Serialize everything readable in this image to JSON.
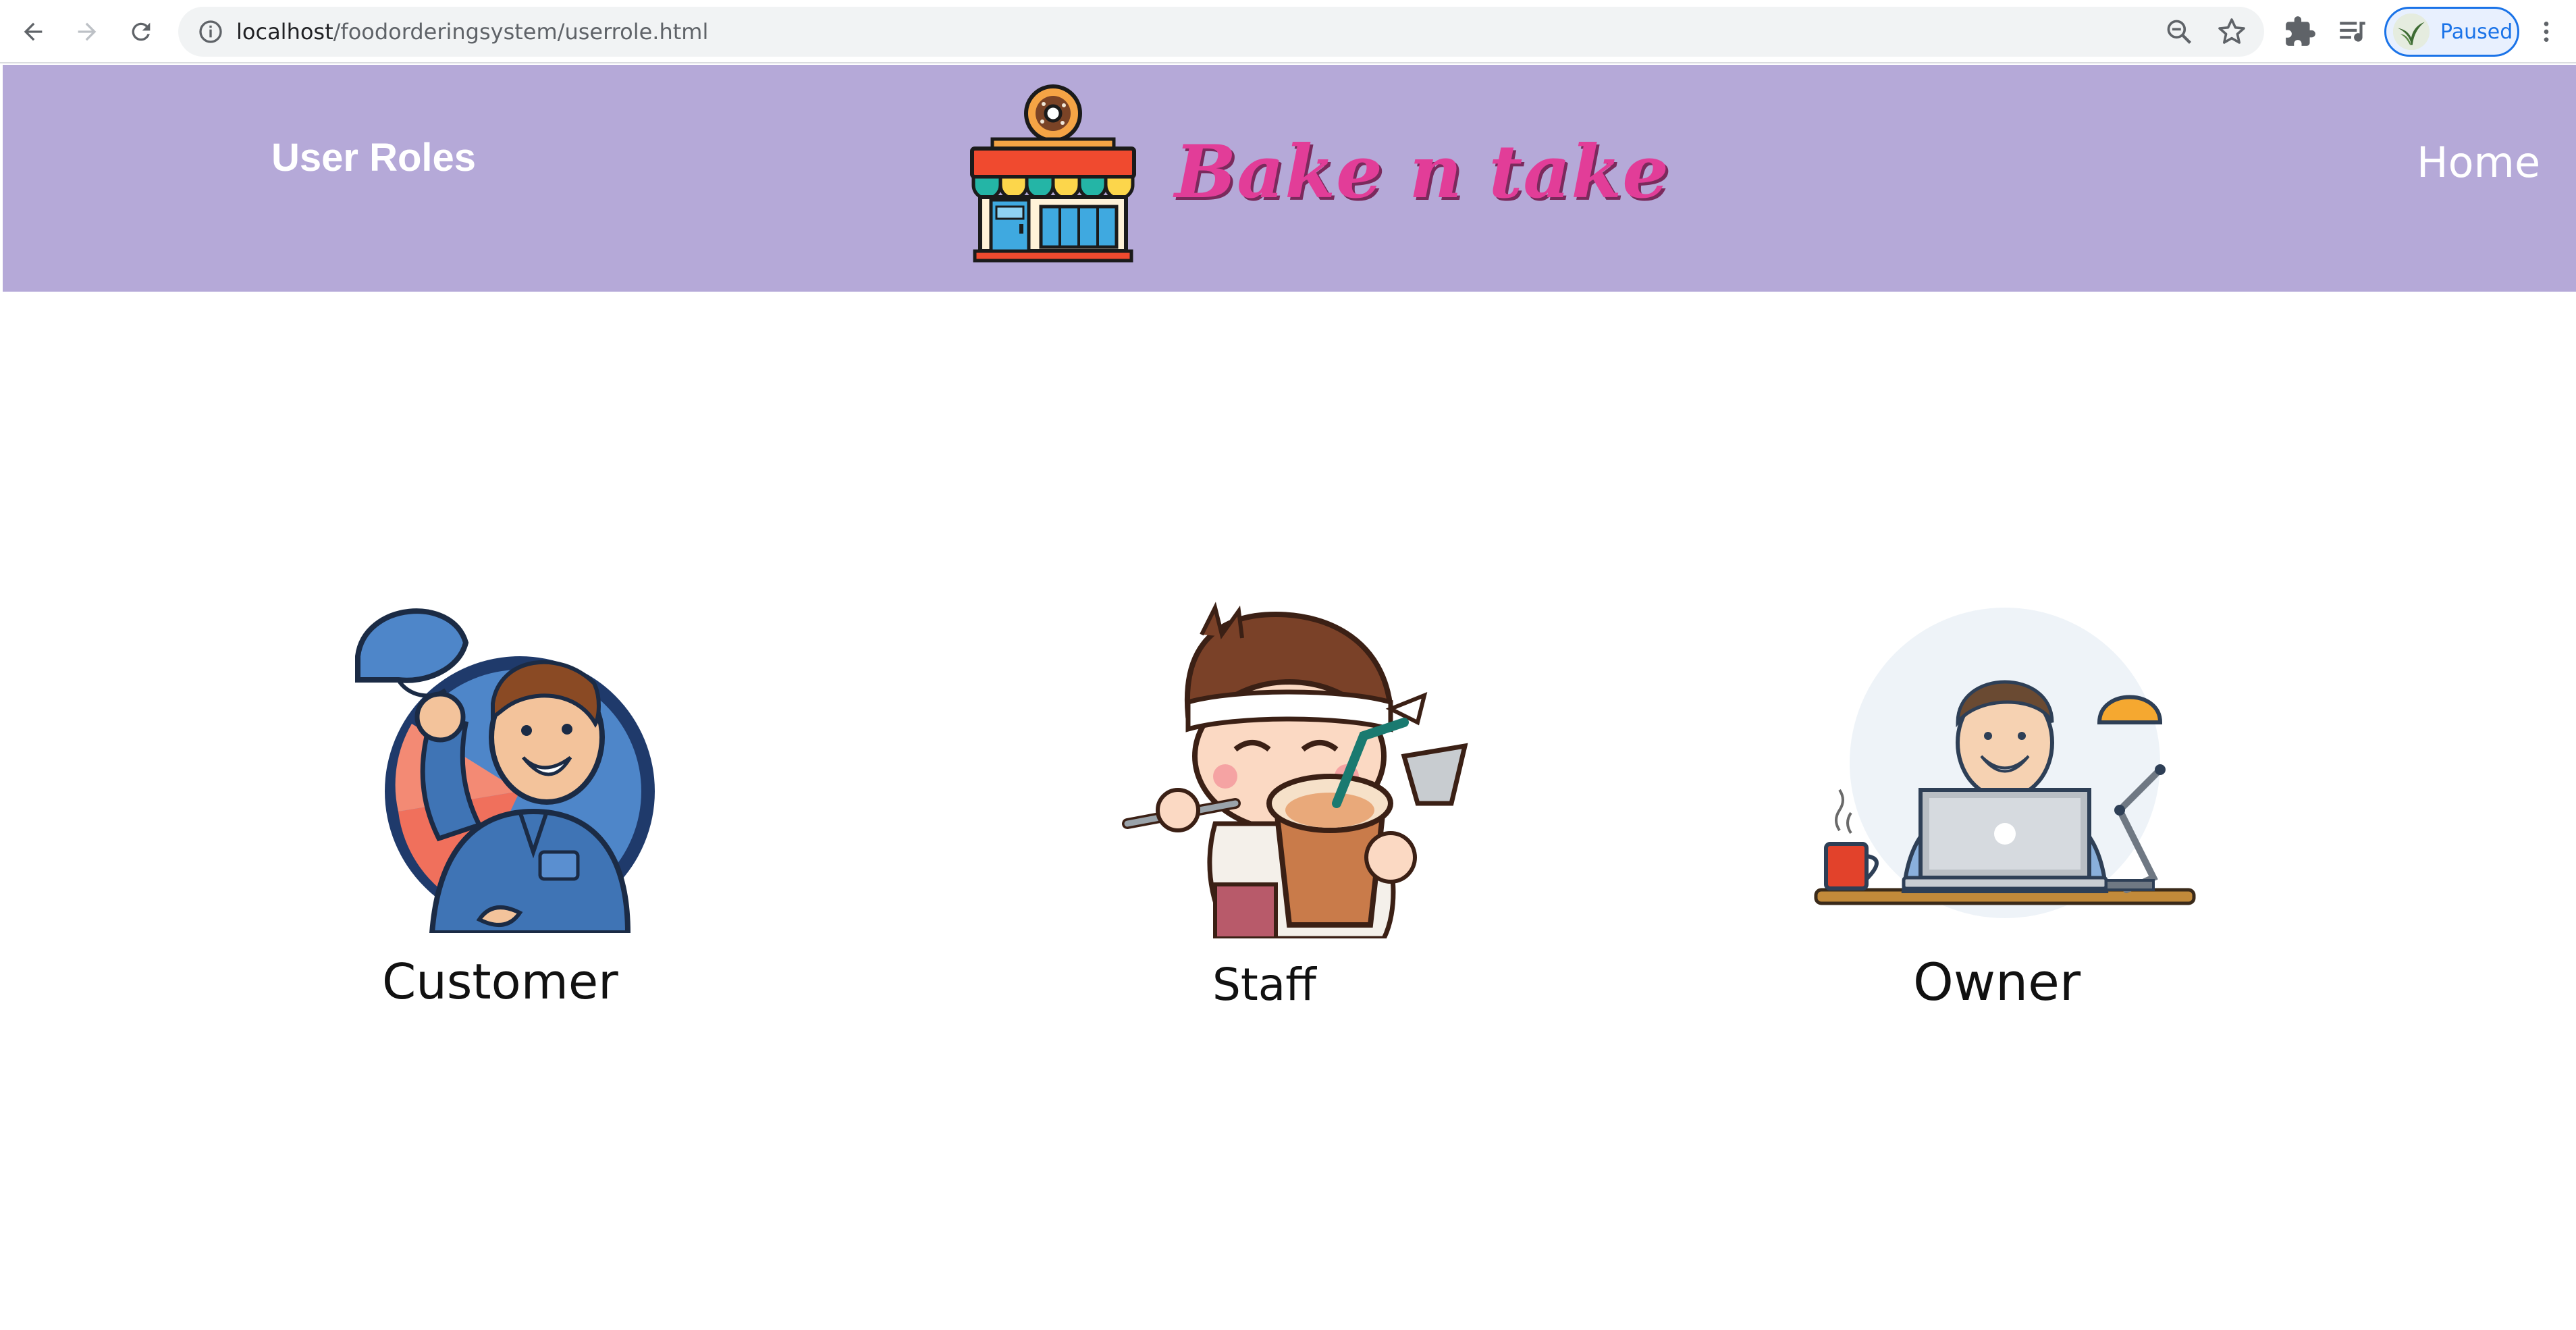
{
  "browser": {
    "url_host": "localhost",
    "url_path": "/foodorderingsystem/userrole.html",
    "profile_label": "Paused",
    "icons": [
      "back-icon",
      "forward-icon",
      "reload-icon",
      "info-icon",
      "zoom-out-icon",
      "star-icon",
      "extensions-icon",
      "media-queue-icon",
      "kebab-menu-icon"
    ]
  },
  "header": {
    "title": "User Roles",
    "brand": "Bake n take",
    "home_link": "Home",
    "background_color": "#b5a9d8",
    "brand_color": "#e23d98"
  },
  "roles": [
    {
      "label": "Customer",
      "icon": "customer-illustration"
    },
    {
      "label": "Staff",
      "icon": "staff-illustration"
    },
    {
      "label": "Owner",
      "icon": "owner-illustration"
    }
  ]
}
